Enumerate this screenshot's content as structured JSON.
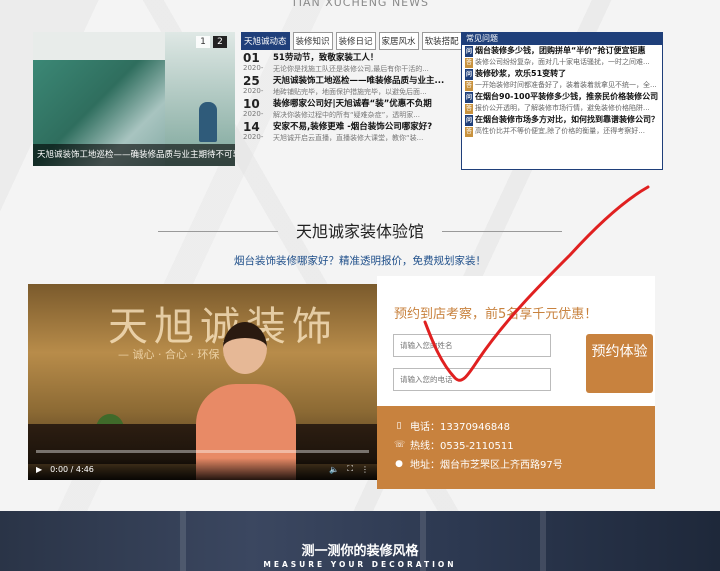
{
  "brand_top": "TIAN XUCHENG NEWS",
  "news": {
    "photo_caption": "天旭诚装饰工地巡检——确装修品质与业主期待不可辜负",
    "pager": [
      "1",
      "2"
    ],
    "tabs": [
      "天旭诚动态",
      "装修知识",
      "装修日记",
      "家居风水",
      "软装搭配"
    ],
    "items": [
      {
        "day": "01",
        "ym": "2020-",
        "title": "51劳动节，致敬家装工人！",
        "desc": "无论你是找施工队还是装修公司,最后有你干活的..."
      },
      {
        "day": "25",
        "ym": "2020-",
        "title": "天旭诚装饰工地巡检——唯装修品质与业主...",
        "desc": "地砖铺贴完毕，地面保护措施完毕，以避免后面..."
      },
      {
        "day": "10",
        "ym": "2020-",
        "title": "装修哪家公司好|天旭诚春“装”优惠不负期",
        "desc": "解决你装修过程中的所有“疑难杂症”，透明家..."
      },
      {
        "day": "14",
        "ym": "2020-",
        "title": "安家不易,装修更难 -烟台装饰公司哪家好?",
        "desc": "天旭诚开启云直播，直播装修大课堂，教你“装..."
      }
    ]
  },
  "faq": {
    "heading": "常见问题",
    "items": [
      {
        "q": "烟台装修多少钱，团购拼单“半价”抢订便宜钜惠",
        "a": "装修公司纷纷复杂，面对几十家电话骚扰，一时之间难..."
      },
      {
        "q": "装修砂浆，欢乐51变转了",
        "a": "一开始装修时间都准备好了，装着装着就拿见不统一，全..."
      },
      {
        "q": "在烟台90-100平装修多少钱，推亲民价格装修公司",
        "a": "报价公开透明，了解装修市场行情，避免装修价格陷阱..."
      },
      {
        "q": "在烟台装修市场多方对比，如何找到靠谱装修公司？",
        "a": "高性价比并不等价便宜,除了价格的衡量，还得考察好..."
      }
    ]
  },
  "experience": {
    "title": "天旭诚家装体验馆",
    "subtitle": "烟台装饰装修哪家好？精准透明报价，免费规划家装！",
    "video": {
      "wall_text": "天旭诚装饰",
      "slogan": "— 诚心 · 合心 · 环保 —",
      "time": "0:00 / 4:46",
      "progress": 0
    },
    "booking": {
      "promo": "预约到店考察，前5名享千元优惠！",
      "name_placeholder": "请输入您的姓名",
      "phone_placeholder": "请输入您的电话",
      "button": "预约体验"
    },
    "contact": {
      "phone": "电话：13370946848",
      "hotline": "热线：0535-2110511",
      "address": "地址：烟台市芝罘区上齐西路97号"
    }
  },
  "banner": {
    "title": "测一测你的装修风格",
    "subtitle": "MEASURE YOUR DECORATION"
  },
  "colors": {
    "brand_blue": "#1f3f7a",
    "accent_orange": "#c8823e",
    "annotation_red": "#e02020"
  }
}
